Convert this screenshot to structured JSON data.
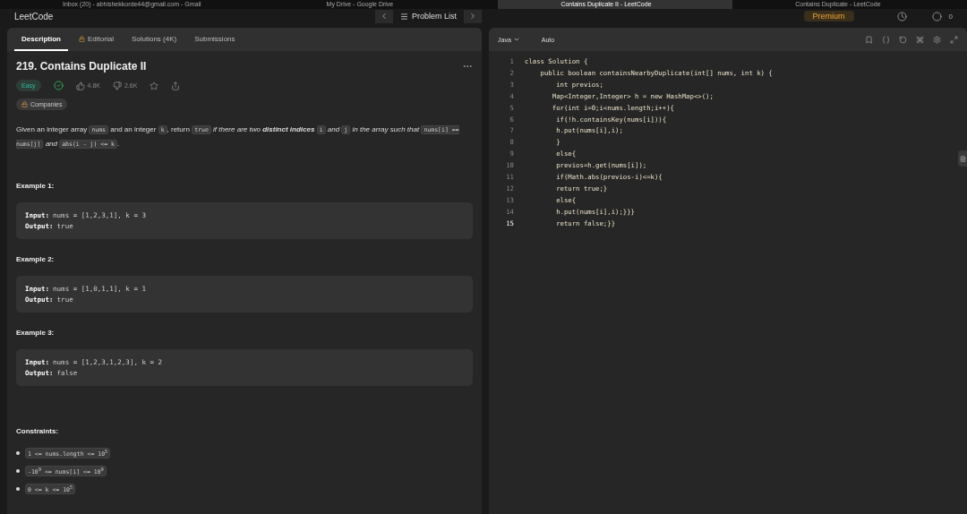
{
  "browser_tabs": [
    {
      "title": "Inbox (20) - abhishekkorde44@gmail.com - Gmail",
      "selected": false
    },
    {
      "title": "My Drive - Google Drive",
      "selected": false
    },
    {
      "title": "Contains Duplicate II - LeetCode",
      "selected": true
    },
    {
      "title": "Contains Duplicate - LeetCode",
      "selected": false
    }
  ],
  "nav": {
    "logo": "LeetCode",
    "problem_list": "Problem List",
    "premium": "Premium",
    "streak": "0"
  },
  "left_tabs": [
    {
      "label": "Description",
      "selected": true,
      "locked": false
    },
    {
      "label": "Editorial",
      "selected": false,
      "locked": true
    },
    {
      "label": "Solutions (4K)",
      "selected": false,
      "locked": false
    },
    {
      "label": "Submissions",
      "selected": false,
      "locked": false
    }
  ],
  "problem": {
    "title": "219. Contains Duplicate II",
    "difficulty": "Easy",
    "solved": true,
    "likes": "4.8K",
    "dislikes": "2.6K",
    "companies": "Companies",
    "description": [
      {
        "kind": "text",
        "text": "Given an integer array "
      },
      {
        "kind": "code",
        "text": "nums"
      },
      {
        "kind": "text",
        "text": " and an integer "
      },
      {
        "kind": "code",
        "text": "k"
      },
      {
        "kind": "text",
        "text": ", return "
      },
      {
        "kind": "code",
        "text": "true"
      },
      {
        "kind": "italic",
        "text": " if there are two "
      },
      {
        "kind": "bolditalic",
        "text": "distinct indices "
      },
      {
        "kind": "code",
        "text": "i"
      },
      {
        "kind": "italic",
        "text": " and "
      },
      {
        "kind": "code",
        "text": "j"
      },
      {
        "kind": "italic",
        "text": " in the array such that "
      },
      {
        "kind": "code",
        "text": "nums[i] == nums[j]"
      },
      {
        "kind": "italic",
        "text": " and "
      },
      {
        "kind": "code",
        "text": "abs(i - j) <= k"
      },
      {
        "kind": "text",
        "text": "."
      }
    ],
    "examples": [
      {
        "title": "Example 1:",
        "input_label": "Input:",
        "input": "nums = [1,2,3,1], k = 3",
        "output_label": "Output:",
        "output": "true"
      },
      {
        "title": "Example 2:",
        "input_label": "Input:",
        "input": "nums = [1,0,1,1], k = 1",
        "output_label": "Output:",
        "output": "true"
      },
      {
        "title": "Example 3:",
        "input_label": "Input:",
        "input": "nums = [1,2,3,1,2,3], k = 2",
        "output_label": "Output:",
        "output": "false"
      }
    ],
    "constraints_title": "Constraints:",
    "constraints": [
      "1 <= nums.length <= 10$^{5}$",
      "-10$^{9}$ <= nums[i] <= 10$^{9}$",
      "0 <= k <= 10$^{5}$"
    ]
  },
  "editor": {
    "language": "Java",
    "mode": "Auto",
    "lines": [
      "class Solution {",
      "    public boolean containsNearbyDuplicate(int[] nums, int k) {",
      "        int previos;",
      "       Map<Integer,Integer> h = new HashMap<>();",
      "       for(int i=0;i<nums.length;i++){",
      "        if(!h.containsKey(nums[i])){",
      "        h.put(nums[i],i);",
      "        }",
      "        else{",
      "        previos=h.get(nums[i]);",
      "        if(Math.abs(previos-i)<=k){",
      "        return true;}",
      "        else{",
      "        h.put(nums[i],i);}}}",
      "        return false;}}"
    ],
    "line_numbers": [
      "1",
      "2",
      "3",
      "4",
      "5",
      "6",
      "7",
      "8",
      "9",
      "10",
      "11",
      "12",
      "13",
      "14",
      "15"
    ]
  }
}
